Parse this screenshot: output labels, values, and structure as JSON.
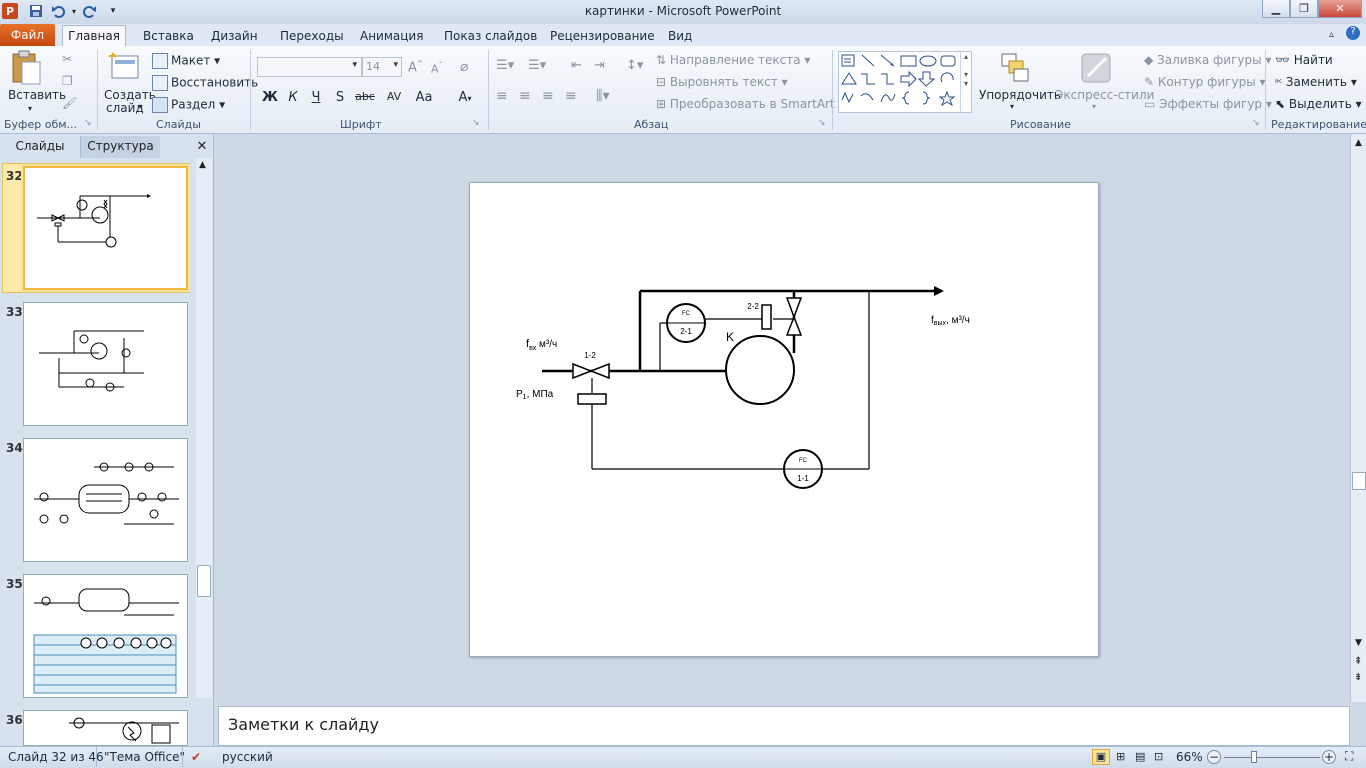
{
  "window": {
    "title": "картинки  -  Microsoft PowerPoint"
  },
  "tabs": [
    "Главная",
    "Вставка",
    "Дизайн",
    "Переходы",
    "Анимация",
    "Показ слайдов",
    "Рецензирование",
    "Вид"
  ],
  "file_tab": "Файл",
  "ribbon": {
    "paste": "Вставить",
    "create_slide": [
      "Создать",
      "слайд"
    ],
    "layout": "Макет",
    "reset": "Восстановить",
    "section": "Раздел",
    "font_size": "14",
    "text_direction": "Направление текста",
    "align_text": "Выровнять текст",
    "smartart": "Преобразовать в SmartArt",
    "arrange": "Упорядочить",
    "quick_styles": "Экспресс-стили",
    "shape_fill": "Заливка фигуры",
    "shape_outline": "Контур фигуры",
    "shape_effects": "Эффекты фигур",
    "find": "Найти",
    "replace": "Заменить",
    "select": "Выделить",
    "format_buttons": [
      "Ж",
      "К",
      "Ч",
      "S",
      "abc",
      "AV",
      "Aa"
    ],
    "groups": {
      "clipboard": "Буфер обм...",
      "slides": "Слайды",
      "font": "Шрифт",
      "paragraph": "Абзац",
      "drawing": "Рисование",
      "editing": "Редактирование"
    }
  },
  "left_pane": {
    "tab_slides": "Слайды",
    "tab_outline": "Структура",
    "slide_numbers": [
      "32",
      "33",
      "34",
      "35",
      "36"
    ]
  },
  "slide": {
    "label_fin": "fвх, м³/ч",
    "label_fin_main": "f",
    "label_fin_sub": "вх",
    "label_fin_unit": " м³/ч",
    "label_fout_main": "f",
    "label_fout_sub": "вых",
    "label_fout_unit": ", м³/ч",
    "label_p1_main": "P",
    "label_p1_sub": "1",
    "label_p1_unit": ", МПа",
    "valve_1_2": "1-2",
    "valve_2_2": "2-2",
    "vessel_k": "K",
    "fc_1_top": "FC",
    "fc_1_bottom": "1-1",
    "fc_2_top": "FC",
    "fc_2_bottom": "2-1"
  },
  "notes": {
    "placeholder": "Заметки к слайду"
  },
  "status": {
    "slide_counter": "Слайд 32 из 46",
    "theme": "\"Тема Office\"",
    "language": "русский",
    "zoom": "66%"
  },
  "colors": {
    "file_tab": "#d2571c",
    "selection": "#f0b93f"
  }
}
